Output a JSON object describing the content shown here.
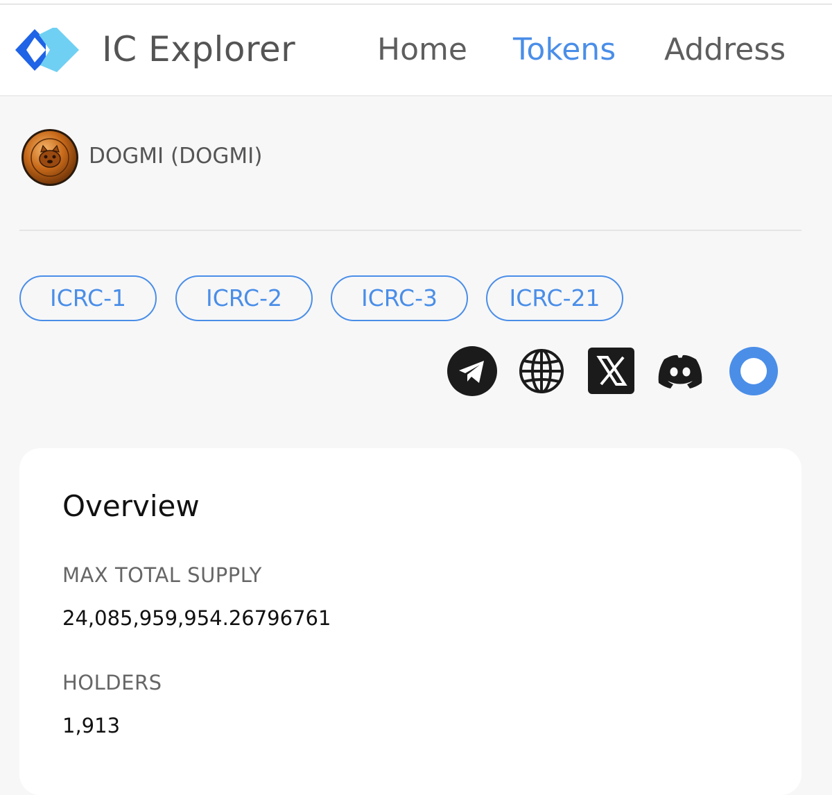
{
  "app": {
    "brand": "IC Explorer"
  },
  "nav": {
    "home": "Home",
    "tokens": "Tokens",
    "address": "Address",
    "active": "Tokens"
  },
  "token": {
    "name": "DOGMI (DOGMI)",
    "logo_text": "DOGMI"
  },
  "standards": [
    "ICRC-1",
    "ICRC-2",
    "ICRC-3",
    "ICRC-21"
  ],
  "social_links": [
    "telegram-icon",
    "globe-icon",
    "x-icon",
    "discord-icon",
    "ring-icon"
  ],
  "overview": {
    "title": "Overview",
    "max_total_supply_label": "MAX TOTAL SUPPLY",
    "max_total_supply_value": "24,085,959,954.26796761",
    "holders_label": "HOLDERS",
    "holders_value": "1,913"
  },
  "colors": {
    "accent": "#4a8ee8",
    "logo_dark": "#1f63e6",
    "logo_light": "#6fd0f3",
    "background": "#f7f7f8"
  }
}
